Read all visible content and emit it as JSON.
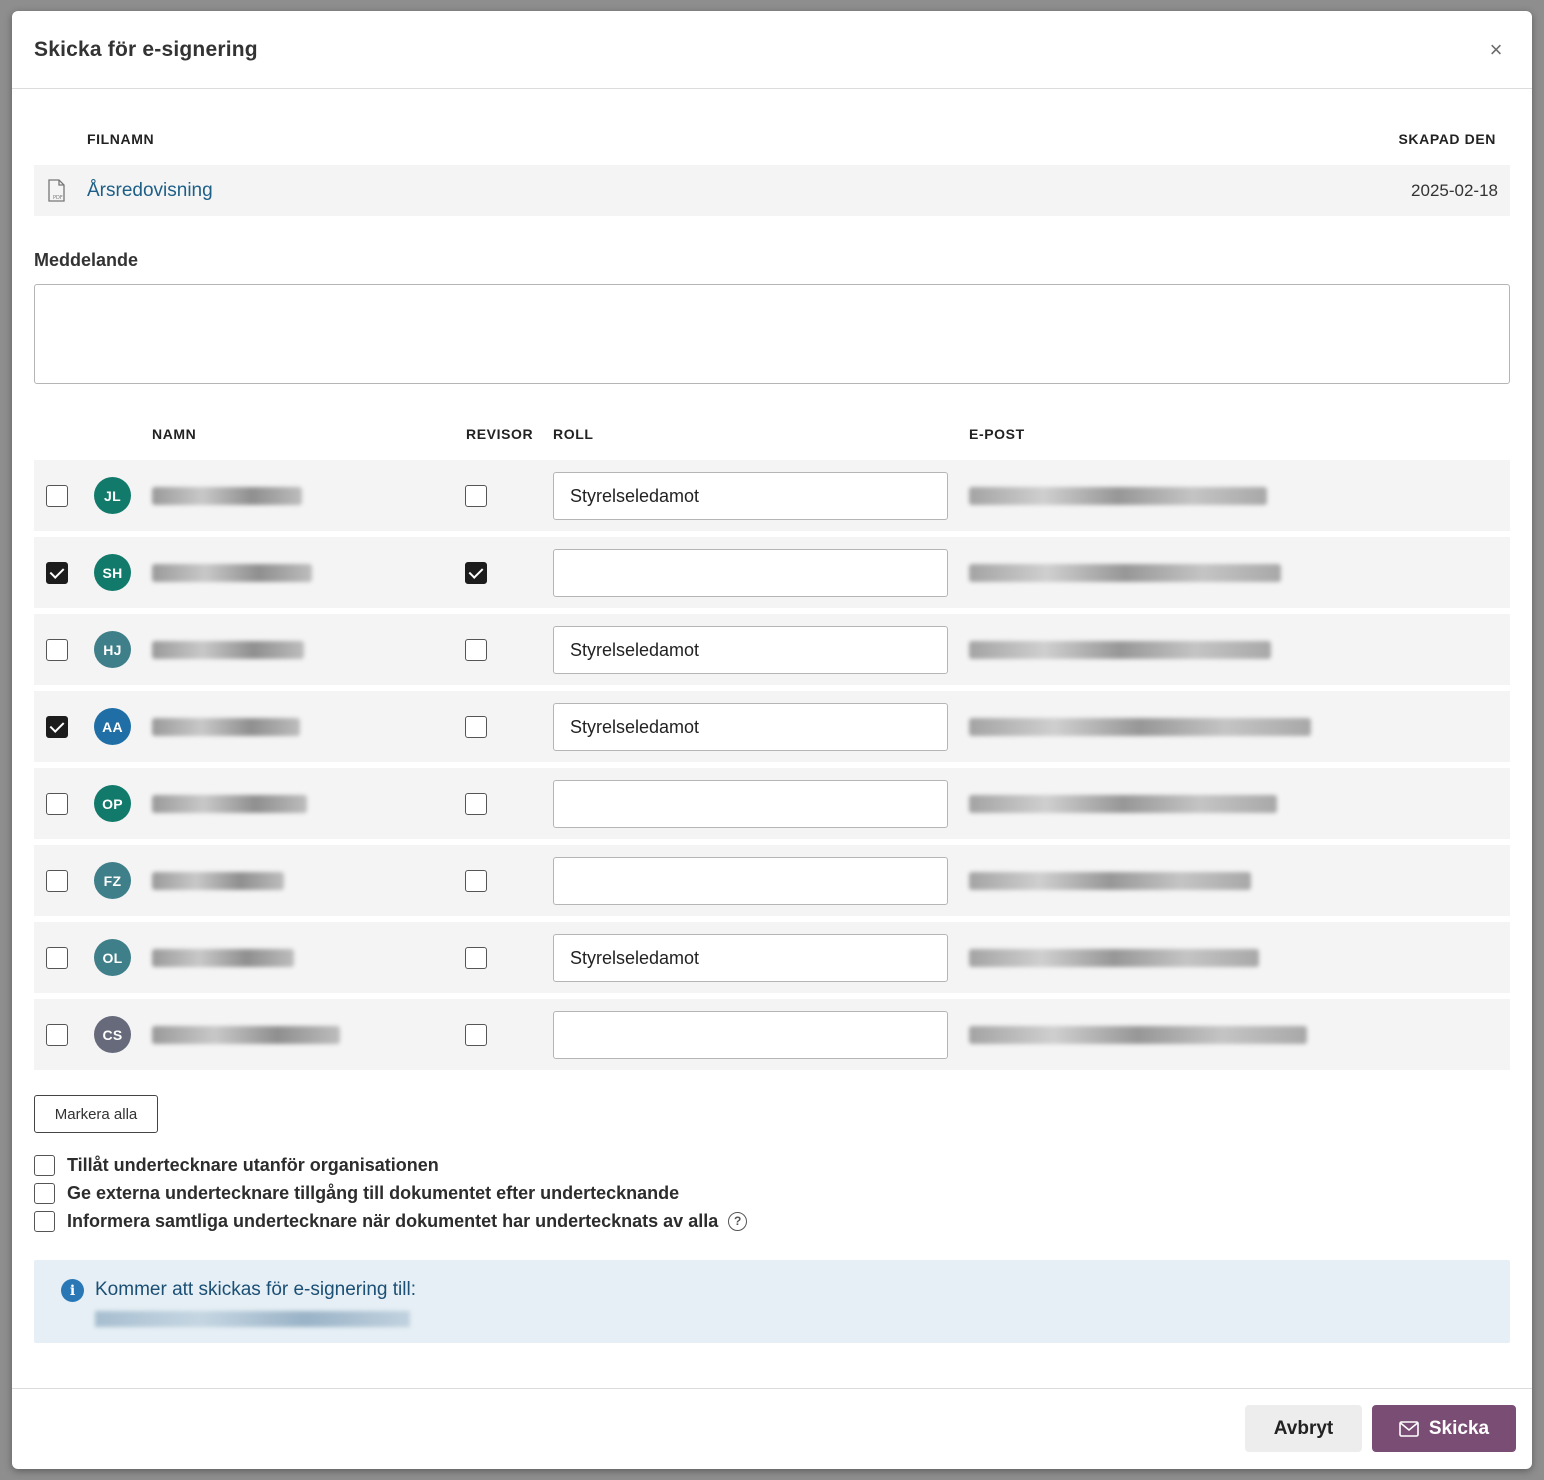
{
  "dialog": {
    "title": "Skicka för e-signering",
    "close_icon": "×"
  },
  "files": {
    "headers": {
      "filename": "FILNAMN",
      "created": "SKAPAD DEN"
    },
    "rows": [
      {
        "icon": "pdf-file-icon",
        "name": "Årsredovisning",
        "created": "2025-02-18"
      }
    ]
  },
  "message": {
    "label": "Meddelande",
    "value": ""
  },
  "signers": {
    "headers": {
      "name": "NAMN",
      "auditor": "REVISOR",
      "role": "ROLL",
      "email": "E-POST"
    },
    "rows": [
      {
        "initials": "JL",
        "avatar_color": "#127a6a",
        "selected": false,
        "auditor": false,
        "role": "Styrelseledamot"
      },
      {
        "initials": "SH",
        "avatar_color": "#127a6a",
        "selected": true,
        "auditor": true,
        "role": ""
      },
      {
        "initials": "HJ",
        "avatar_color": "#3f7f8a",
        "selected": false,
        "auditor": false,
        "role": "Styrelseledamot"
      },
      {
        "initials": "AA",
        "avatar_color": "#1f6fa6",
        "selected": true,
        "auditor": false,
        "role": "Styrelseledamot"
      },
      {
        "initials": "OP",
        "avatar_color": "#127a6a",
        "selected": false,
        "auditor": false,
        "role": ""
      },
      {
        "initials": "FZ",
        "avatar_color": "#3f7f8a",
        "selected": false,
        "auditor": false,
        "role": ""
      },
      {
        "initials": "OL",
        "avatar_color": "#3f7f8a",
        "selected": false,
        "auditor": false,
        "role": "Styrelseledamot"
      },
      {
        "initials": "CS",
        "avatar_color": "#666a7a",
        "selected": false,
        "auditor": false,
        "role": ""
      }
    ]
  },
  "mark_all_label": "Markera alla",
  "options": [
    {
      "label": "Tillåt undertecknare utanför organisationen",
      "checked": false
    },
    {
      "label": "Ge externa undertecknare tillgång till dokumentet efter undertecknande",
      "checked": false
    },
    {
      "label": "Informera samtliga undertecknare när dokumentet har undertecknats av alla",
      "checked": false,
      "help_icon": "question-circle-icon"
    }
  ],
  "info": {
    "icon": "info-icon",
    "text": "Kommer att skickas för e-signering till:"
  },
  "footer": {
    "cancel_label": "Avbryt",
    "send_label": "Skicka",
    "send_icon": "envelope-icon"
  },
  "colors": {
    "primary_button": "#7a4d75",
    "link": "#1e5f87",
    "info_bg": "#e6eff5"
  }
}
